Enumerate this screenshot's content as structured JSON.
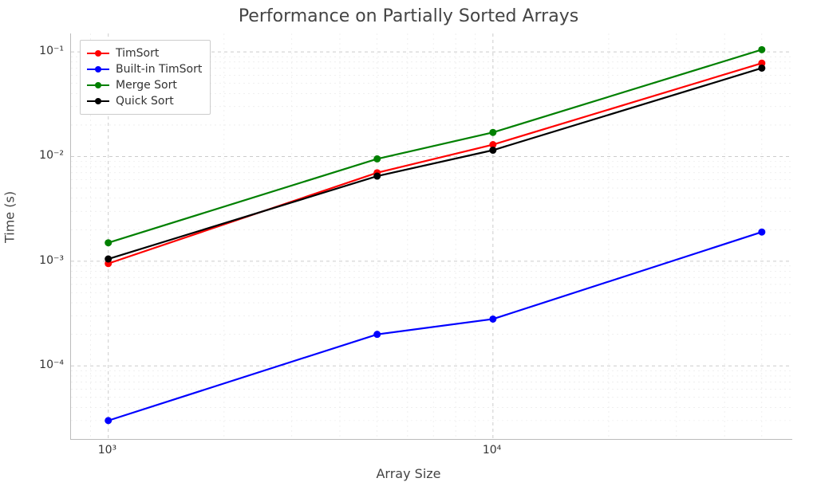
{
  "title": "Performance on Partially Sorted Arrays",
  "xlabel": "Array Size",
  "ylabel": "Time (s)",
  "chart_data": {
    "type": "line",
    "xscale": "log",
    "yscale": "log",
    "xlim": [
      800,
      60000
    ],
    "ylim": [
      2e-05,
      0.15
    ],
    "x": [
      1000,
      5000,
      10000,
      50000
    ],
    "series": [
      {
        "name": "TimSort",
        "color": "#ff0000",
        "values": [
          0.00095,
          0.007,
          0.013,
          0.078
        ]
      },
      {
        "name": "Built-in TimSort",
        "color": "#0000ff",
        "values": [
          3e-05,
          0.0002,
          0.00028,
          0.0019
        ]
      },
      {
        "name": "Merge Sort",
        "color": "#008000",
        "values": [
          0.0015,
          0.0095,
          0.017,
          0.105
        ]
      },
      {
        "name": "Quick Sort",
        "color": "#000000",
        "values": [
          0.00105,
          0.0065,
          0.0115,
          0.07
        ]
      }
    ],
    "xticks_major": [
      1000,
      10000
    ],
    "yticks_major": [
      0.0001,
      0.001,
      0.01,
      0.1
    ],
    "xtick_labels": [
      "10³",
      "10⁴"
    ],
    "ytick_labels": [
      "10⁻⁴",
      "10⁻³",
      "10⁻²",
      "10⁻¹"
    ],
    "legend_loc": "upper left",
    "grid": true
  }
}
